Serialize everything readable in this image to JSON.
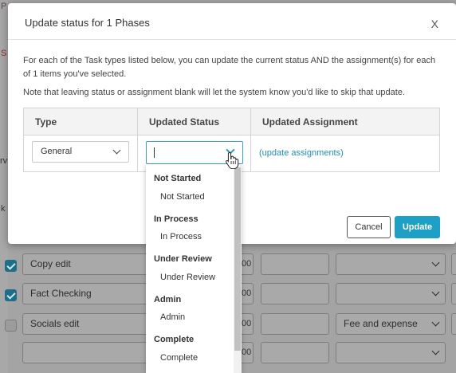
{
  "modal": {
    "title": "Update status for 1 Phases",
    "close_label": "X",
    "intro": "For each of the Task types listed below, you can update the current status AND the assignment(s) for each of 1 items you've selected.",
    "note": "Note that leaving status or assignment blank will let the system know you'd like to skip that update.",
    "columns": [
      "Type",
      "Updated Status",
      "Updated Assignment"
    ],
    "row": {
      "type_value": "General",
      "status_value": "",
      "assign_link": "(update assignments)"
    },
    "cancel_label": "Cancel",
    "update_label": "Update"
  },
  "dropdown": {
    "groups": [
      {
        "label": "Not Started",
        "option": "Not Started"
      },
      {
        "label": "In Process",
        "option": "In Process"
      },
      {
        "label": "Under Review",
        "option": "Under Review"
      },
      {
        "label": "Admin",
        "option": "Admin"
      },
      {
        "label": "Complete",
        "option": "Complete"
      }
    ]
  },
  "background": {
    "fragments": [
      "P",
      "S",
      "rv",
      "k"
    ],
    "rows": [
      {
        "checked": true,
        "title": "Copy edit",
        "num": "00",
        "assignment": ""
      },
      {
        "checked": true,
        "title": "Fact Checking",
        "num": "00",
        "assignment": ""
      },
      {
        "checked": false,
        "title": "Socials edit",
        "num": "00",
        "assignment": "Fee and expense"
      },
      {
        "checked": false,
        "title": "",
        "num": "00",
        "assignment": ""
      }
    ]
  },
  "colors": {
    "accent": "#1e9fc6",
    "link": "#1f8fae",
    "focus_border": "#3aa3b7",
    "checkbox_checked": "#1d6e86"
  }
}
